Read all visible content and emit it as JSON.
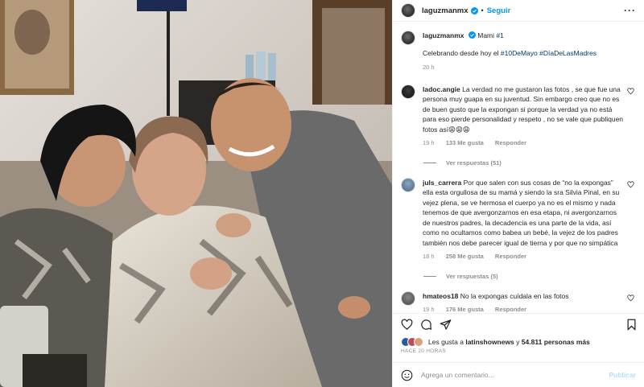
{
  "header": {
    "username": "laguzmanmx",
    "separator": "•",
    "follow_label": "Seguir",
    "more_icon": "more-horizontal-icon"
  },
  "caption": {
    "username": "laguzmanmx",
    "text_line1": "Mami",
    "tag1": "#1",
    "text_line2": "Celebrando desde hoy el",
    "tag2": "#10DeMayo",
    "tag3": "#DíaDeLasMadres",
    "time": "20 h"
  },
  "comments": [
    {
      "username": "ladoc.angie",
      "text": "La verdad no me gustaron las fotos , se que fue una persona muy guapa en su juventud. Sin embargo creo que no es de buen gusto que la expongan si porque la verdad ya no está para eso pierde personalidad y respeto , no se vale que publiquen fotos así😩😩😩",
      "time": "19 h",
      "likes": "133 Me gusta",
      "reply": "Responder",
      "view_replies": "Ver respuestas (51)"
    },
    {
      "username": "juls_carrera",
      "text": "Por que salen con sus cosas de “no la expongas” ella esta orgullosa de su mamá y siendo la sra Silvia Pinal, en su vejez plena, se ve hermosa el cuerpo ya no es el mismo y nada tenemos de que avergonzarnos en esa etapa, ni avergonzarnos de nuestros padres, la decadencia es una parte de la vida, así como no ocultamos como babea un bebé, la vejez de los padres también nos debe parecer igual de tierna y por que no simpática",
      "time": "18 h",
      "likes": "258 Me gusta",
      "reply": "Responder",
      "view_replies": "Ver respuestas (5)"
    },
    {
      "username": "hmateos18",
      "text": "No la expongas cuídala en las fotos",
      "time": "19 h",
      "likes": "176 Me gusta",
      "reply": "Responder"
    }
  ],
  "likes": {
    "prefix": "Les gusta a",
    "user": "latinshownews",
    "middle": "y",
    "count": "54.811 personas más"
  },
  "posted_ago": "HACE 20 HORAS",
  "add_comment": {
    "placeholder": "Agrega un comentario...",
    "publish_label": "Publicar"
  },
  "colors": {
    "accent": "#0095f6",
    "hashtag": "#00376b",
    "muted": "#8e8e8e",
    "publish_disabled": "#b2dffc"
  }
}
